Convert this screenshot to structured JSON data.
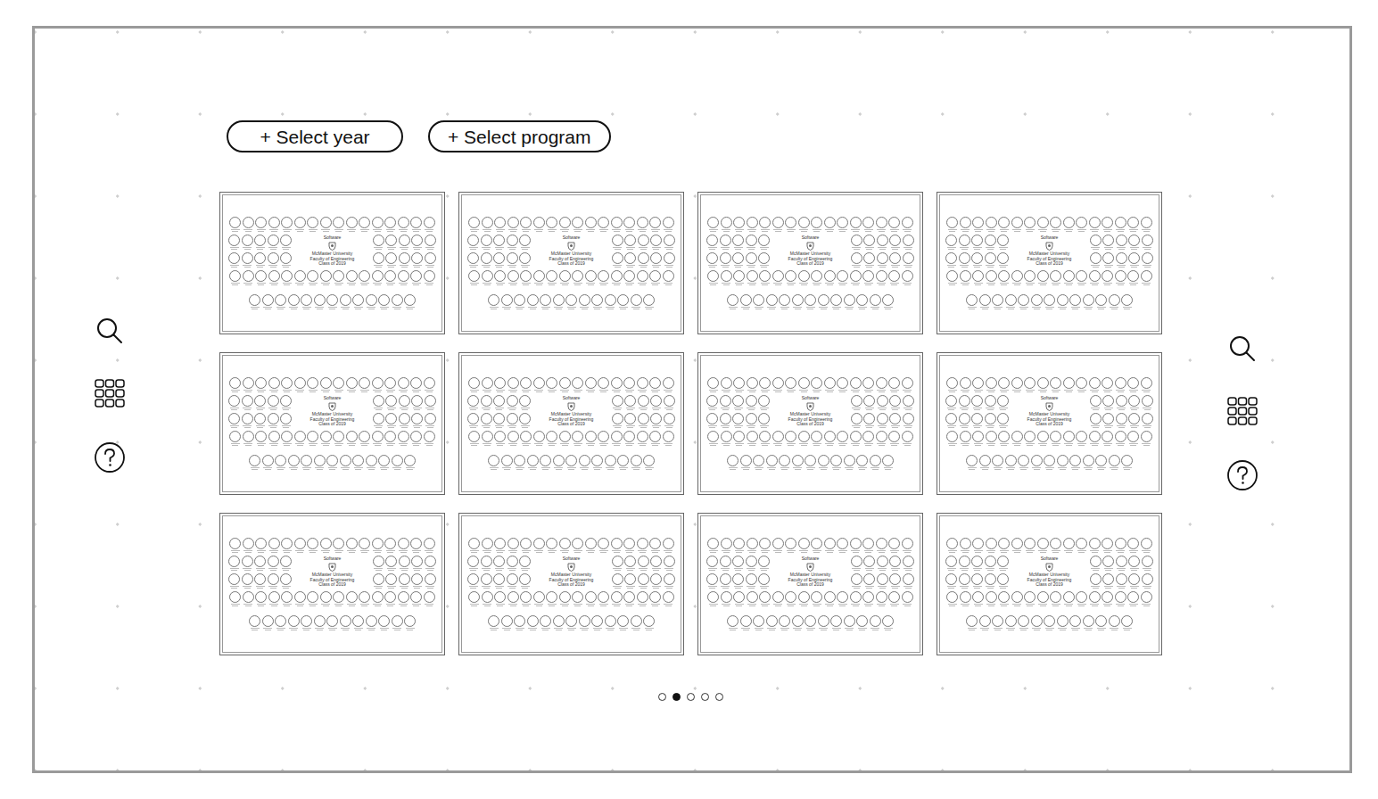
{
  "filters": [
    {
      "label": "+ Select year"
    },
    {
      "label": "+ Select program"
    }
  ],
  "composites": [
    {
      "program": "Software",
      "school": "McMaster University",
      "faculty": "Faculty of Engineering",
      "class": "Class of 2019"
    },
    {
      "program": "Software",
      "school": "McMaster University",
      "faculty": "Faculty of Engineering",
      "class": "Class of 2019"
    },
    {
      "program": "Software",
      "school": "McMaster University",
      "faculty": "Faculty of Engineering",
      "class": "Class of 2019"
    },
    {
      "program": "Software",
      "school": "McMaster University",
      "faculty": "Faculty of Engineering",
      "class": "Class of 2019"
    },
    {
      "program": "Software",
      "school": "McMaster University",
      "faculty": "Faculty of Engineering",
      "class": "Class of 2019"
    },
    {
      "program": "Software",
      "school": "McMaster University",
      "faculty": "Faculty of Engineering",
      "class": "Class of 2019"
    },
    {
      "program": "Software",
      "school": "McMaster University",
      "faculty": "Faculty of Engineering",
      "class": "Class of 2019"
    },
    {
      "program": "Software",
      "school": "McMaster University",
      "faculty": "Faculty of Engineering",
      "class": "Class of 2019"
    },
    {
      "program": "Software",
      "school": "McMaster University",
      "faculty": "Faculty of Engineering",
      "class": "Class of 2019"
    },
    {
      "program": "Software",
      "school": "McMaster University",
      "faculty": "Faculty of Engineering",
      "class": "Class of 2019"
    },
    {
      "program": "Software",
      "school": "McMaster University",
      "faculty": "Faculty of Engineering",
      "class": "Class of 2019"
    },
    {
      "program": "Software",
      "school": "McMaster University",
      "faculty": "Faculty of Engineering",
      "class": "Class of 2019"
    }
  ],
  "pagination": [
    {
      "selected": false
    },
    {
      "selected": true
    },
    {
      "selected": false
    },
    {
      "selected": false
    },
    {
      "selected": false
    }
  ]
}
